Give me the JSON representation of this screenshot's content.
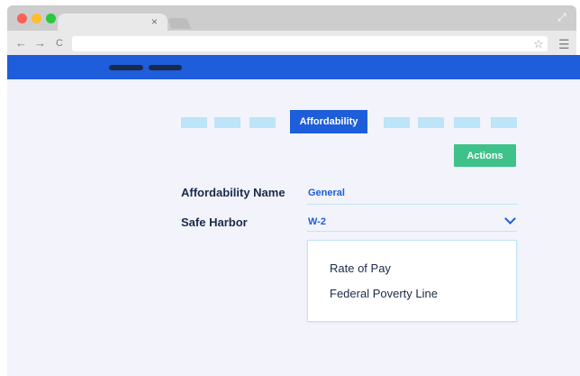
{
  "browser": {
    "traffic_colors": [
      "#ff5f57",
      "#febc2e",
      "#28c840"
    ],
    "tab_close": "×",
    "nav_back": "←",
    "nav_forward": "→",
    "nav_reload": "C",
    "url": "",
    "bookmark_icon": "star-icon",
    "menu_icon": "hamburger-icon",
    "expand_icon": "expand-icon"
  },
  "app": {
    "brand_color": "#1e5edb"
  },
  "stepper": {
    "active_label": "Affordability",
    "active_color": "#1e5edb",
    "inactive_color": "#bde4f8"
  },
  "actions": {
    "label": "Actions",
    "color": "#3ec28a"
  },
  "form": {
    "affordability_name_label": "Affordability Name",
    "affordability_name_value": "General",
    "safe_harbor_label": "Safe Harbor",
    "safe_harbor_value": "W-2"
  },
  "dropdown": {
    "options": [
      "Rate of Pay",
      "Federal Poverty Line"
    ]
  }
}
